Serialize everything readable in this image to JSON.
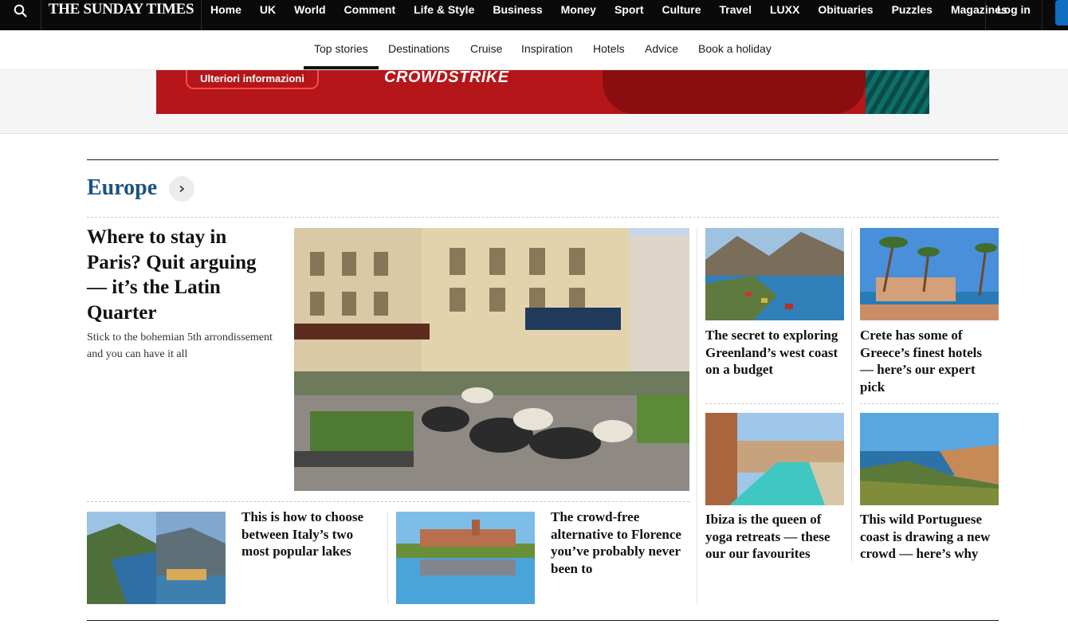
{
  "topnav": {
    "logo": "THE SUNDAY TIMES",
    "links": [
      "Home",
      "UK",
      "World",
      "Comment",
      "Life & Style",
      "Business",
      "Money",
      "Sport",
      "Culture",
      "Travel",
      "LUXX",
      "Obituaries",
      "Puzzles",
      "Magazines"
    ],
    "login": "Log in",
    "search_icon": "search-icon"
  },
  "subnav": {
    "items": [
      "Top stories",
      "Destinations",
      "Cruise",
      "Inspiration",
      "Hotels",
      "Advice",
      "Book a holiday"
    ],
    "active": "Top stories"
  },
  "ad": {
    "button": "Ulteriori informazioni",
    "brand": "CROWDSTRIKE"
  },
  "section": {
    "title": "Europe",
    "arrow_icon": "chevron-right-icon"
  },
  "lead": {
    "headline": "Where to stay in Paris? Quit arguing — it’s the Latin Quarter",
    "standfirst": "Stick to the bohemian 5th arrondissement and you can have it all"
  },
  "cards": {
    "greenland": "The secret to exploring Greenland’s west coast on a budget",
    "crete": "Crete has some of Greece’s finest hotels — here’s our expert pick",
    "ibiza": "Ibiza is the queen of yoga retreats — these our our favourites",
    "portugal": "This wild Portuguese coast is drawing a new crowd — here’s why",
    "italy_lakes": "This is how to choose between Italy’s two most popular lakes",
    "florence_alt": "The crowd-free alternative to Florence you’ve probably never been to"
  },
  "colors": {
    "nav_bg": "#0a0a0a",
    "section_title": "#1a5380",
    "accent_blue": "#0f6ec2",
    "ad_red": "#b5161a"
  }
}
